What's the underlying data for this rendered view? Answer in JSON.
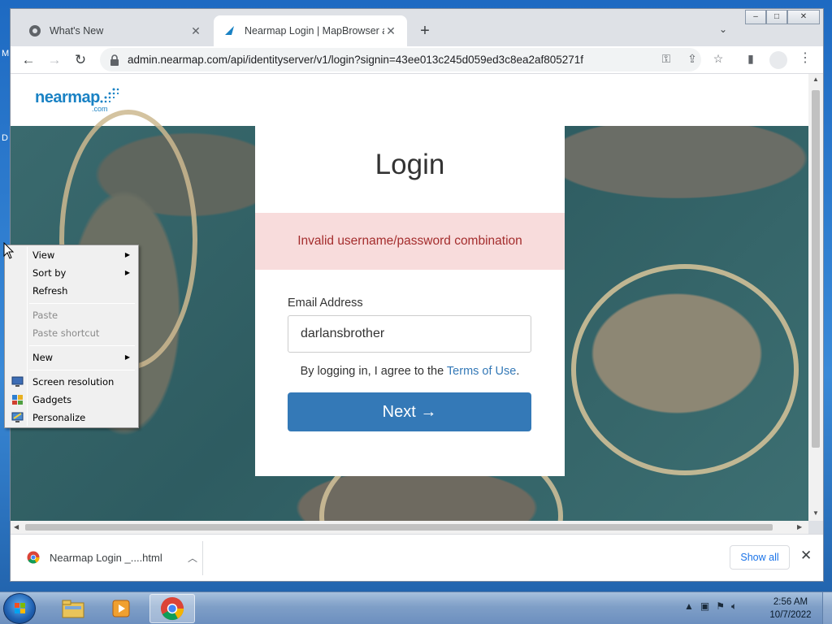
{
  "desktop": {
    "edge_text_1": "M",
    "edge_text_2": "D"
  },
  "browser": {
    "tabs": [
      {
        "title": "What's New",
        "active": false
      },
      {
        "title": "Nearmap Login | MapBrowser an",
        "active": true
      }
    ],
    "new_tab_label": "+",
    "url": "admin.nearmap.com/api/identityserver/v1/login?signin=43ee013c245d059ed3c8ea2af805271f",
    "window_controls": {
      "minimize": "–",
      "restore": "□",
      "close": "✕"
    }
  },
  "page": {
    "logo_text": "nearmap",
    "logo_sub": ".com",
    "login_title": "Login",
    "error_message": "Invalid username/password combination",
    "email_label": "Email Address",
    "email_value": "darlansbrother",
    "terms_prefix": "By logging in, I agree to the ",
    "terms_link": "Terms of Use",
    "terms_suffix": ".",
    "next_button": "Next →"
  },
  "download_bar": {
    "file_name": "Nearmap Login _....html",
    "show_all": "Show all"
  },
  "context_menu": {
    "items": [
      {
        "label": "View",
        "submenu": true,
        "disabled": false
      },
      {
        "label": "Sort by",
        "submenu": true,
        "disabled": false
      },
      {
        "label": "Refresh",
        "submenu": false,
        "disabled": false
      },
      {
        "label": "Paste",
        "submenu": false,
        "disabled": true
      },
      {
        "label": "Paste shortcut",
        "submenu": false,
        "disabled": true
      },
      {
        "label": "New",
        "submenu": true,
        "disabled": false
      },
      {
        "label": "Screen resolution",
        "submenu": false,
        "disabled": false
      },
      {
        "label": "Gadgets",
        "submenu": false,
        "disabled": false
      },
      {
        "label": "Personalize",
        "submenu": false,
        "disabled": false
      }
    ]
  },
  "taskbar": {
    "time": "2:56 AM",
    "date": "10/7/2022"
  },
  "colors": {
    "accent": "#3479b7",
    "alert_bg": "#f8dcdc",
    "alert_text": "#a42d2d",
    "logo": "#1a82c4"
  }
}
